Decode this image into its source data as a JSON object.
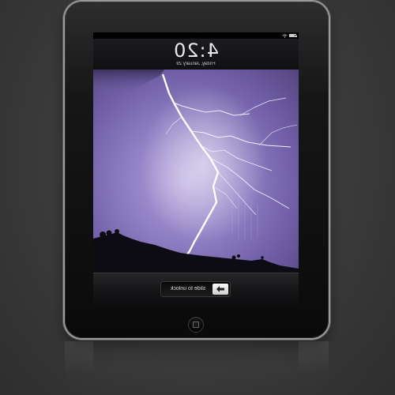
{
  "lock_screen": {
    "time": "4:20",
    "date": "Friday, January 29",
    "unlock_label": "slide to unlock"
  },
  "status_bar": {
    "icons": [
      "wifi-icon",
      "battery-icon"
    ]
  },
  "wallpaper": {
    "subject": "lightning",
    "colors": {
      "sky_light": "#b7a6dd",
      "sky_mid": "#9080c4",
      "sky_dark": "#54457f",
      "bolt": "#ffffff",
      "hills": "#0d0b14"
    }
  },
  "device": {
    "bezel_color": "#0a0a0a",
    "frame_color": "#9a9a9a",
    "home_button_icon": "home-square-icon"
  }
}
